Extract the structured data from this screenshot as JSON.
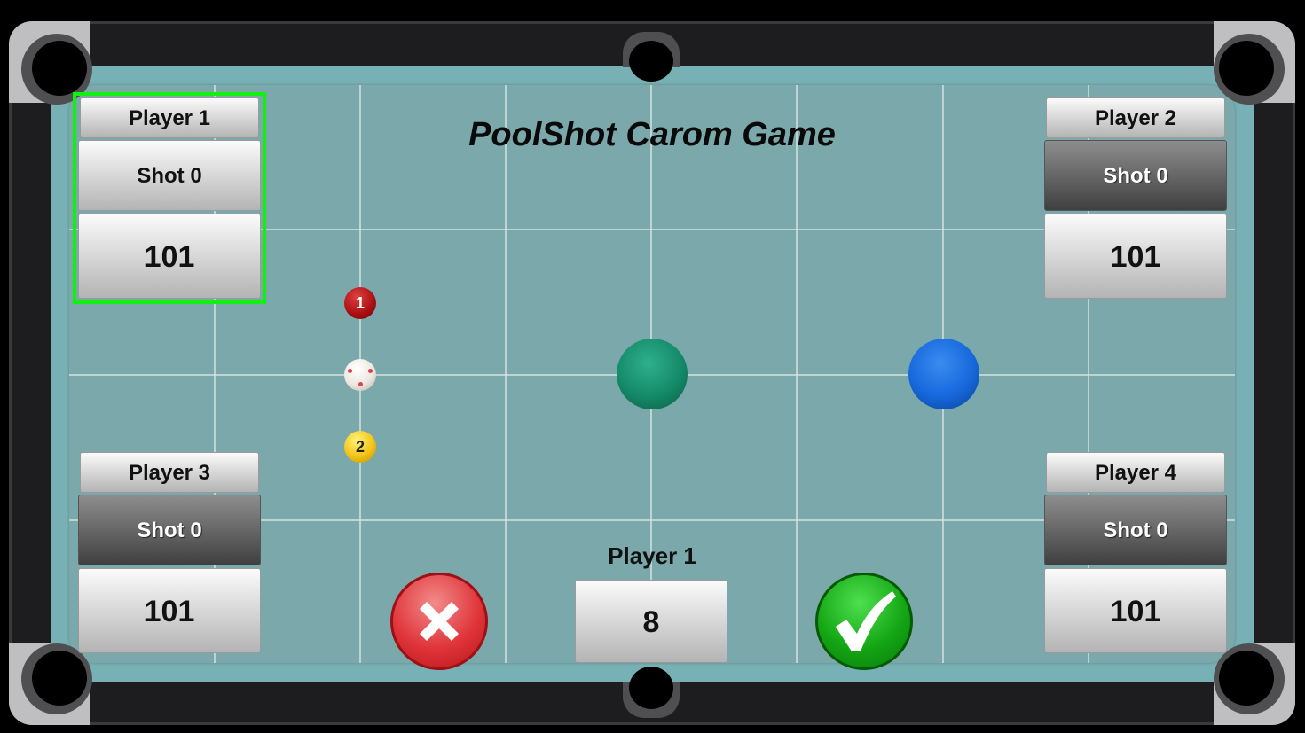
{
  "title": "PoolShot Carom Game",
  "players": [
    {
      "name": "Player 1",
      "shot": "Shot 0",
      "score": "101",
      "active": true
    },
    {
      "name": "Player 2",
      "shot": "Shot 0",
      "score": "101",
      "active": false
    },
    {
      "name": "Player 3",
      "shot": "Shot 0",
      "score": "101",
      "active": false
    },
    {
      "name": "Player 4",
      "shot": "Shot 0",
      "score": "101",
      "active": false
    }
  ],
  "balls": {
    "red": {
      "label": "1"
    },
    "cue": {
      "label": ""
    },
    "yellow": {
      "label": "2"
    }
  },
  "turn": {
    "player_label": "Player 1",
    "shot_value": "8"
  },
  "icons": {
    "cancel": "close-icon",
    "confirm": "checkmark-icon"
  },
  "colors": {
    "cloth": "#7ba8aa",
    "active_highlight": "#12f012",
    "cancel": "#e0353a",
    "confirm": "#14a614"
  }
}
